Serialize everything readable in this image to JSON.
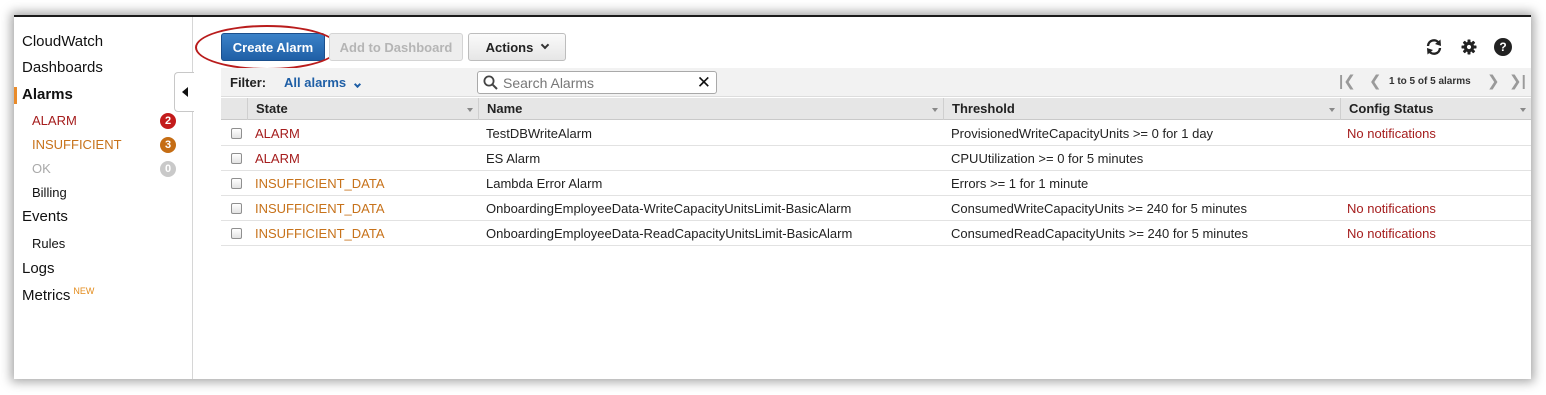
{
  "sidebar": {
    "cloudwatch": "CloudWatch",
    "dashboards": "Dashboards",
    "alarms": "Alarms",
    "alarm_states": [
      {
        "label": "ALARM",
        "count": "2",
        "color": "#a51d1d",
        "badge_color": "#c31b1b"
      },
      {
        "label": "INSUFFICIENT",
        "count": "3",
        "color": "#c7721a",
        "badge_color": "#c56d14"
      },
      {
        "label": "OK",
        "count": "0",
        "color": "#a9a9a9",
        "badge_color": "#c9c9c9"
      }
    ],
    "billing": "Billing",
    "events": "Events",
    "rules": "Rules",
    "logs": "Logs",
    "metrics": "Metrics",
    "metrics_badge": "NEW"
  },
  "toolbar": {
    "create_alarm": "Create Alarm",
    "add_to_dashboard": "Add to Dashboard",
    "actions": "Actions",
    "icons": [
      "refresh-icon",
      "gear-icon",
      "help-icon"
    ]
  },
  "filter": {
    "label": "Filter:",
    "value": "All alarms",
    "search_placeholder": "Search Alarms"
  },
  "pager": {
    "text": "1 to 5 of 5 alarms"
  },
  "table": {
    "columns": [
      "State",
      "Name",
      "Threshold",
      "Config Status"
    ],
    "rows": [
      {
        "state": "ALARM",
        "name": "TestDBWriteAlarm",
        "threshold": "ProvisionedWriteCapacityUnits >= 0 for 1 day",
        "config": "No notifications"
      },
      {
        "state": "ALARM",
        "name": "ES Alarm",
        "threshold": "CPUUtilization >= 0 for 5 minutes",
        "config": ""
      },
      {
        "state": "INSUFFICIENT_DATA",
        "name": "Lambda Error Alarm",
        "threshold": "Errors >= 1 for 1 minute",
        "config": ""
      },
      {
        "state": "INSUFFICIENT_DATA",
        "name": "OnboardingEmployeeData-WriteCapacityUnitsLimit-BasicAlarm",
        "threshold": "ConsumedWriteCapacityUnits >= 240 for 5 minutes",
        "config": "No notifications"
      },
      {
        "state": "INSUFFICIENT_DATA",
        "name": "OnboardingEmployeeData-ReadCapacityUnitsLimit-BasicAlarm",
        "threshold": "ConsumedReadCapacityUnits >= 240 for 5 minutes",
        "config": "No notifications"
      }
    ]
  },
  "colors": {
    "alarm_state": "#a51d1d",
    "insufficient_state": "#c7721a",
    "no_notifications": "#a51d1d",
    "primary_button": "#1f5fa6",
    "highlight_ring": "#b91c1c"
  }
}
